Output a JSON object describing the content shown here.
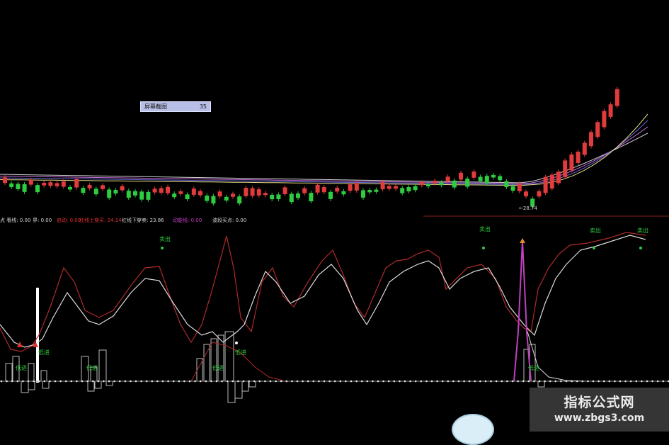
{
  "tooltip": {
    "label": "屏幕截图",
    "value": "35"
  },
  "price_panel": {
    "low_marker": "←28.74"
  },
  "indicator_legend": [
    {
      "label": "点 看线: 0.00",
      "color": "#d8d8d8"
    },
    {
      "label": "界: 0.00",
      "color": "#d8d8d8"
    },
    {
      "label": "启动: 0.00",
      "color": "#e03030"
    },
    {
      "label": "红线上穿买: 24.14",
      "color": "#e03030"
    },
    {
      "label": "红线下穿卖: 23.86",
      "color": "#d8d8d8"
    },
    {
      "label": "动能线: 0.00",
      "color": "#c040c0"
    },
    {
      "label": "波段买点: 0.00",
      "color": "#d8d8d8"
    }
  ],
  "signals": {
    "sell_label": "卖出",
    "buy_label": "低进",
    "extra_buy_label": "低进"
  },
  "watermark": {
    "title": "指标公式网",
    "url": "www.zbgs3.com"
  },
  "colors": {
    "up_candle": "#e23b3b",
    "down_candle": "#2ecc40",
    "ma_lines": [
      "#d0d0d0",
      "#c46ad8",
      "#6a6adc",
      "#e8e080"
    ],
    "indicator_red": "#b02a2a",
    "indicator_white": "#dcdcdc",
    "momentum": "#c040c0"
  }
}
